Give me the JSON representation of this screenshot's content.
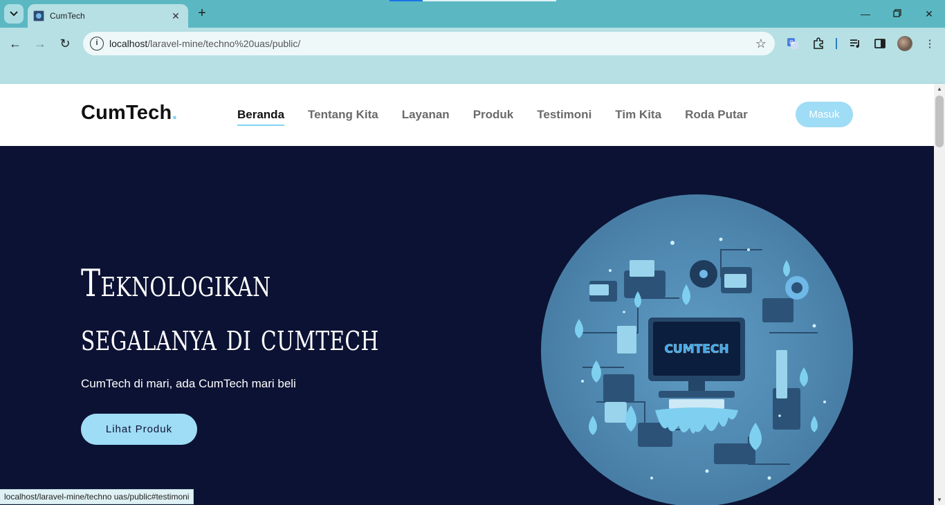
{
  "browser": {
    "tab_title": "CumTech",
    "url_host": "localhost",
    "url_path": "/laravel-mine/techno%20uas/public/",
    "status_url": "localhost/laravel-mine/techno uas/public#testimoni"
  },
  "site": {
    "logo_text": "CumTech",
    "logo_dot": ".",
    "nav": [
      {
        "label": "Beranda",
        "active": true
      },
      {
        "label": "Tentang Kita"
      },
      {
        "label": "Layanan"
      },
      {
        "label": "Produk"
      },
      {
        "label": "Testimoni"
      },
      {
        "label": "Tim Kita"
      },
      {
        "label": "Roda Putar"
      }
    ],
    "login_label": "Masuk"
  },
  "hero": {
    "title_line1": "Teknologikan",
    "title_line2": "segalanya di cumtech",
    "subtitle": "CumTech di mari, ada CumTech mari beli",
    "cta_label": "Lihat Produk",
    "art_screen_text": "CUMTECH"
  },
  "colors": {
    "accent": "#9fdcf5",
    "hero_bg": "#0c1233",
    "tabstrip": "#5bb8c2",
    "toolbar": "#b6e0e4"
  }
}
